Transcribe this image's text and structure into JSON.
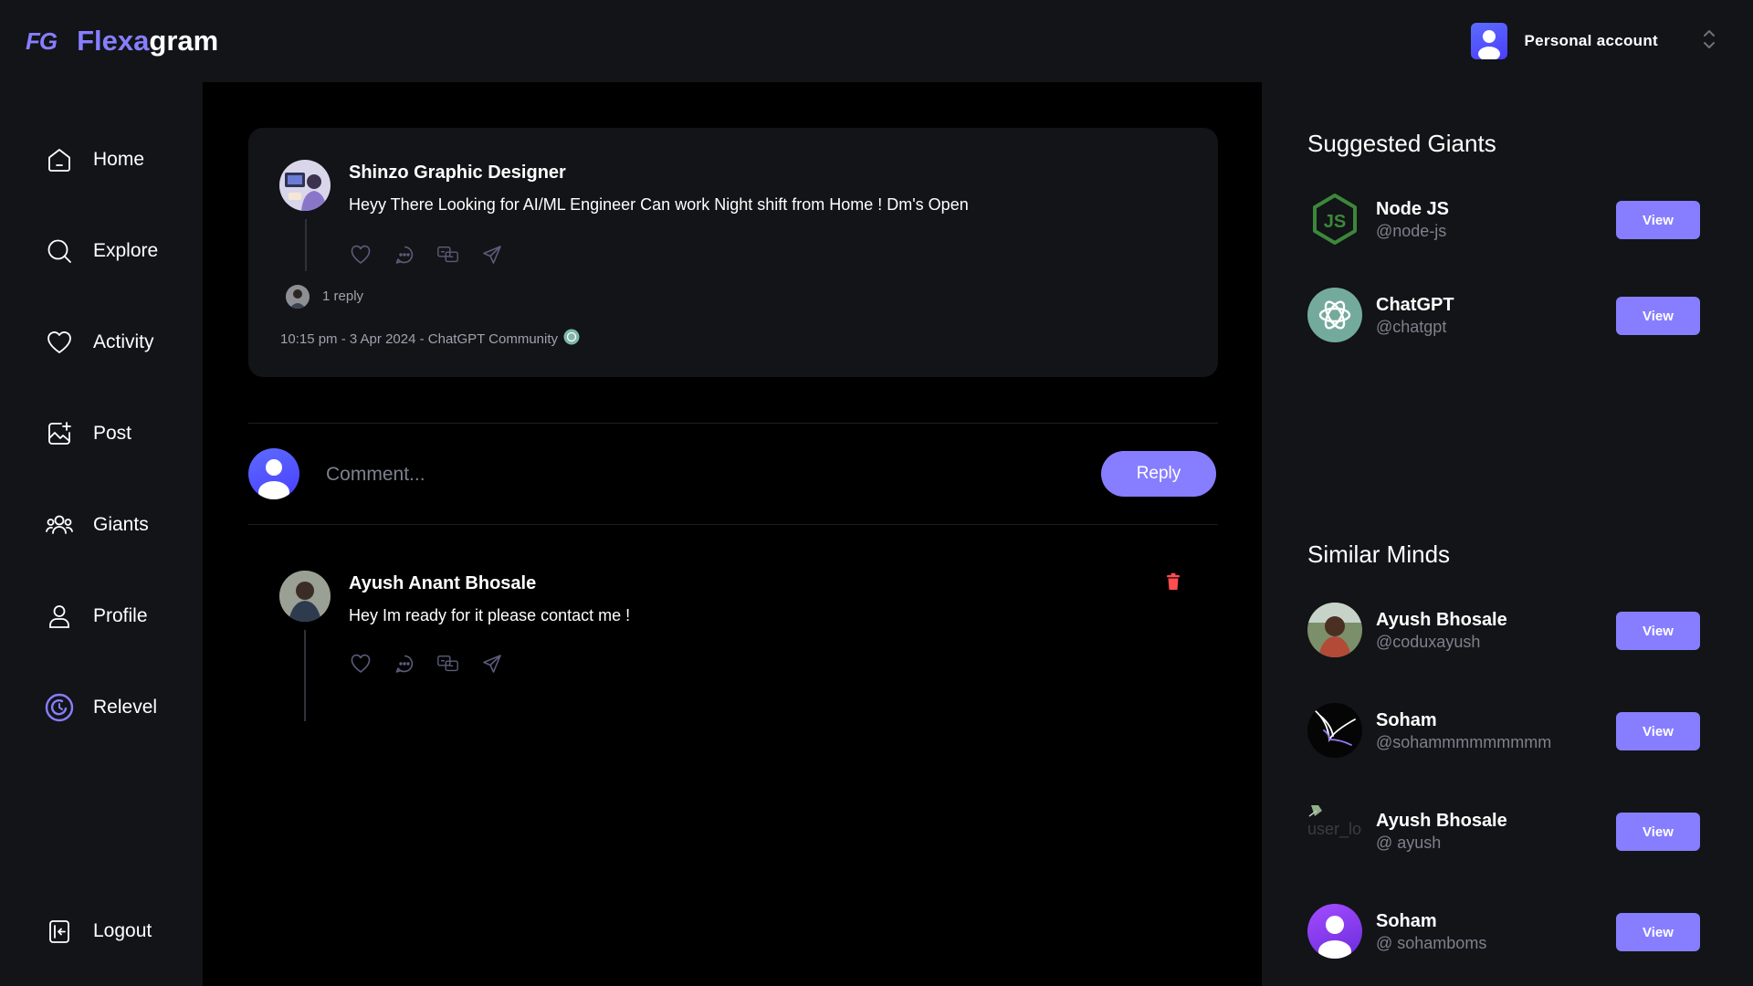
{
  "app": {
    "logo_mark": "FG",
    "name_part1": "Flexa",
    "name_part2": "gram",
    "account_label": "Personal account",
    "accent_color": "#877eff"
  },
  "sidebar": {
    "items": [
      {
        "label": "Home",
        "icon": "home-icon"
      },
      {
        "label": "Explore",
        "icon": "search-icon"
      },
      {
        "label": "Activity",
        "icon": "heart-icon"
      },
      {
        "label": "Post",
        "icon": "image-plus-icon"
      },
      {
        "label": "Giants",
        "icon": "users-icon"
      },
      {
        "label": "Profile",
        "icon": "user-icon"
      },
      {
        "label": "Relevel",
        "icon": "relevel-icon"
      }
    ],
    "logout_label": "Logout"
  },
  "thread": {
    "author": "Shinzo Graphic Designer",
    "text": "Heyy There Looking for AI/ML Engineer Can work Night shift from Home ! Dm's Open",
    "replies": "1 reply",
    "meta": "10:15 pm - 3 Apr 2024 - ChatGPT Community"
  },
  "composer": {
    "placeholder": "Comment...",
    "reply_label": "Reply"
  },
  "comment": {
    "author": "Ayush Anant Bhosale",
    "text": "Hey Im ready for it please contact me !"
  },
  "right": {
    "suggested_title": "Suggested Giants",
    "suggested": [
      {
        "name": "Node JS",
        "handle": "@node-js",
        "action": "View"
      },
      {
        "name": "ChatGPT",
        "handle": "@chatgpt",
        "action": "View"
      }
    ],
    "similar_title": "Similar Minds",
    "similar": [
      {
        "name": "Ayush Bhosale",
        "handle": "@coduxayush",
        "action": "View"
      },
      {
        "name": "Soham",
        "handle": "@sohammmmmmmmm",
        "action": "View"
      },
      {
        "name": "Ayush Bhosale",
        "handle": "@ ayush",
        "action": "View",
        "broken_image_alt": "user_logo"
      },
      {
        "name": "Soham",
        "handle": "@ sohamboms",
        "action": "View"
      }
    ]
  }
}
